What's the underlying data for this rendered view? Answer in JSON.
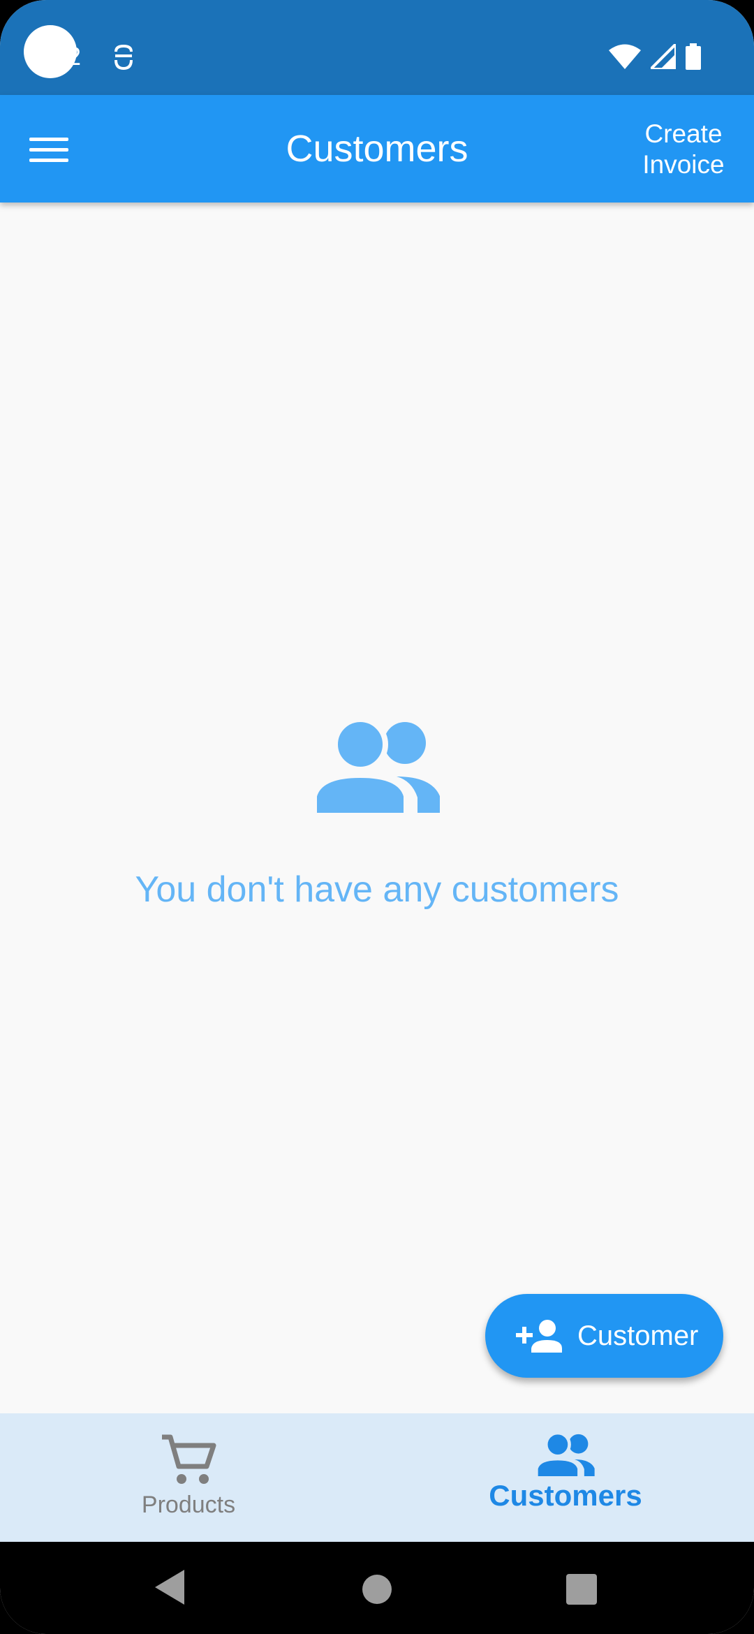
{
  "status_bar": {
    "time": "2",
    "icons": [
      "camera-dot",
      "settings-status-icon",
      "wifi-icon",
      "signal-icon",
      "battery-icon"
    ]
  },
  "app_bar": {
    "title": "Customers",
    "menu_icon": "hamburger-menu-icon",
    "action_label": "Create Invoice"
  },
  "empty_state": {
    "icon": "people-icon",
    "message": "You don't have any customers"
  },
  "fab": {
    "icon": "person-add-icon",
    "label": "Customer"
  },
  "bottom_nav": {
    "items": [
      {
        "label": "Products",
        "icon": "shopping-cart-icon",
        "active": false
      },
      {
        "label": "Customers",
        "icon": "people-icon",
        "active": true
      }
    ]
  },
  "system_nav": {
    "buttons": [
      "back-icon",
      "home-icon",
      "recents-icon"
    ]
  },
  "colors": {
    "status_bar": "#1B72B8",
    "primary": "#2196F3",
    "empty_accent": "#64B5F6",
    "nav_background": "#DAEAF8",
    "nav_active": "#1E88E5",
    "nav_inactive": "#7F7F7F"
  }
}
